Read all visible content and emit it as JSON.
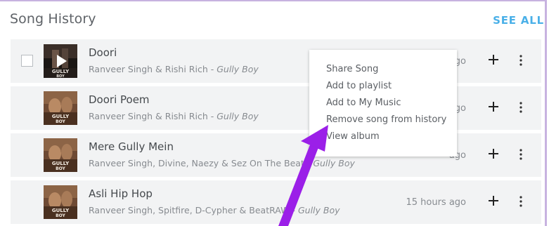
{
  "header": {
    "title": "Song History",
    "see_all": "SEE ALL"
  },
  "songs": [
    {
      "title": "Doori",
      "artists": "Ranveer Singh & Rishi Rich - ",
      "album": "Gully Boy",
      "time": "ago"
    },
    {
      "title": "Doori Poem",
      "artists": "Ranveer Singh & Rishi Rich - ",
      "album": "Gully Boy",
      "time": "go"
    },
    {
      "title": "Mere Gully Mein",
      "artists": "Ranveer Singh, Divine, Naezy & Sez On The Beat - ",
      "album": "Gully Boy",
      "time": "ago"
    },
    {
      "title": "Asli Hip Hop",
      "artists": "Ranveer Singh, Spitfire, D-Cypher & BeatRAW - ",
      "album": "Gully Boy",
      "time": "15 hours ago"
    }
  ],
  "thumb_text": {
    "line1": "GULLY",
    "line2": "BOY"
  },
  "context_menu": {
    "items": [
      "Share Song",
      "Add to playlist",
      "Add to My Music",
      "Remove song from history",
      "View album"
    ]
  },
  "colors": {
    "accent": "#4ab0e8",
    "arrow": "#9b1fe8",
    "row_bg": "#f2f3f4",
    "frame": "#c7b2e0"
  },
  "icons": {
    "add": "plus-icon",
    "more": "more-vertical-icon",
    "play": "play-icon"
  }
}
